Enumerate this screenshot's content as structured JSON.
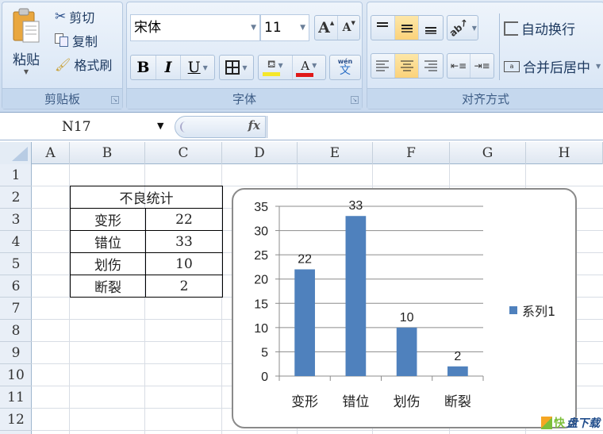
{
  "ribbon": {
    "clipboard": {
      "label": "剪贴板",
      "paste": "粘贴",
      "cut": "剪切",
      "copy": "复制",
      "format_painter": "格式刷"
    },
    "font": {
      "label": "字体",
      "font_name": "宋体",
      "font_size": "11",
      "grow": "A",
      "shrink": "A",
      "bold": "B",
      "italic": "I",
      "underline": "U",
      "fill_color": "#f5e72a",
      "font_color": "#e01818",
      "phonetic": "wén"
    },
    "alignment": {
      "label": "对齐方式",
      "wrap_text": "自动换行",
      "merge_center": "合并后居中"
    }
  },
  "formula_bar": {
    "name_box": "N17",
    "fx": "fx",
    "formula": ""
  },
  "columns": [
    "A",
    "B",
    "C",
    "D",
    "E",
    "F",
    "G",
    "H"
  ],
  "rows": [
    "1",
    "2",
    "3",
    "4",
    "5",
    "6",
    "7",
    "8",
    "9",
    "10",
    "11",
    "12"
  ],
  "table": {
    "title": "不良统计",
    "rows": [
      {
        "label": "变形",
        "value": "22"
      },
      {
        "label": "错位",
        "value": "33"
      },
      {
        "label": "划伤",
        "value": "10"
      },
      {
        "label": "断裂",
        "value": "2"
      }
    ]
  },
  "chart_data": {
    "type": "bar",
    "title": "",
    "categories": [
      "变形",
      "错位",
      "划伤",
      "断裂"
    ],
    "series": [
      {
        "name": "系列1",
        "values": [
          22,
          33,
          10,
          2
        ],
        "color": "#4f81bd"
      }
    ],
    "yticks": [
      "0",
      "5",
      "10",
      "15",
      "20",
      "25",
      "30",
      "35"
    ],
    "ylim": [
      0,
      35
    ],
    "grid": true,
    "data_labels": true,
    "legend": "right",
    "xlabel": "",
    "ylabel": ""
  },
  "watermark": {
    "brand": "快",
    "text": "盘下载"
  }
}
